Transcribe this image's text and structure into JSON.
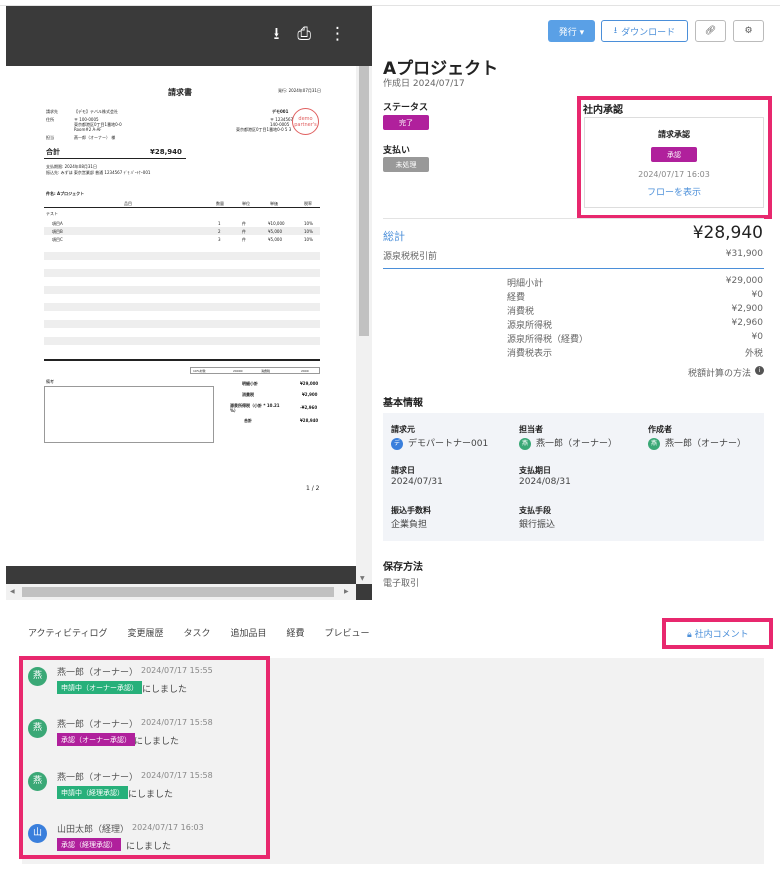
{
  "viewer": {
    "download_icon": "download-icon",
    "print_icon": "print-icon",
    "more_icon": "more-vert-icon",
    "page_indicator": "1 / 2",
    "invoice": {
      "title": "請求書",
      "issue_date": "発行: 2024年07月31日",
      "to_label": "請求先",
      "to_name": "【デモ】テバル株式会社",
      "address_label": "住所",
      "address_lines": [
        "〒 100-0005",
        "東京都港区0丁目1番地0-0",
        "Room#2 A-AF"
      ],
      "person_label": "担当",
      "person_name": "燕一郎（オーナー） 様",
      "from_company": "デモ001",
      "from_lines": [
        "〒 1234567",
        "140-0005",
        "東京都港区0丁目1番地0-0 5 3"
      ],
      "stamp_text": "demo partner's",
      "total_label": "合計",
      "total_value": "¥28,940",
      "due_line": "支払期限: 2024年08月31日",
      "bank_line": "振込先: みずほ 東京営業部 普通 1234567 ﾃﾞﾓ ﾊﾟｰﾄﾅｰ001",
      "subject": "件名: Aプロジェクト",
      "col_headers": [
        "品目",
        "数量",
        "単位",
        "単価",
        "税率"
      ],
      "group_label": "テスト",
      "rows": [
        [
          "項目A",
          "1",
          "件",
          "¥10,000",
          "10%"
        ],
        [
          "項目B",
          "2",
          "件",
          "¥5,000",
          "10%"
        ],
        [
          "項目C",
          "3",
          "件",
          "¥5,000",
          "10%"
        ]
      ],
      "tax_summary": [
        "10%対象",
        "29000",
        "消費税",
        "2900"
      ],
      "memo_label": "備考",
      "summary_labels": [
        "明細小計",
        "消費税",
        "源泉所得税（小計 * 10.21 %）",
        "合計"
      ],
      "summary_values": [
        "¥29,000",
        "¥2,900",
        "-¥2,960",
        "¥28,940"
      ]
    }
  },
  "toolbar": {
    "issue_label": "発行 ▾",
    "download_label": "ダウンロード",
    "link_icon": "link-icon",
    "gear_icon": "gear-icon"
  },
  "project": {
    "title": "Aプロジェクト",
    "created": "作成日 2024/07/17",
    "status_label": "ステータス",
    "status_badge": "完了",
    "payment_label": "支払い",
    "payment_badge": "未処理"
  },
  "approval": {
    "heading": "社内承認",
    "card_title": "請求承認",
    "badge": "承認",
    "timestamp": "2024/07/17 16:03",
    "flow_link": "フローを表示"
  },
  "totals": {
    "label": "総計",
    "value": "¥28,940",
    "pre_withholding_label": "源泉税税引前",
    "pre_withholding_value": "¥31,900",
    "breakdown": [
      {
        "label": "明細小計",
        "value": "¥29,000"
      },
      {
        "label": "経費",
        "value": "¥0"
      },
      {
        "label": "消費税",
        "value": "¥2,900"
      },
      {
        "label": "源泉所得税",
        "value": "¥2,960"
      },
      {
        "label": "源泉所得税（経費）",
        "value": "¥0"
      },
      {
        "label": "消費税表示",
        "value": "外税"
      }
    ],
    "tax_method_link": "税額計算の方法"
  },
  "basic": {
    "heading": "基本情報",
    "billing_to_label": "請求元",
    "billing_to_avatar": "デ",
    "billing_to_value": "デモパートナー001",
    "assignee_label": "担当者",
    "assignee_avatar": "燕",
    "assignee_value": "燕一郎（オーナー）",
    "creator_label": "作成者",
    "creator_avatar": "燕",
    "creator_value": "燕一郎（オーナー）",
    "invoice_date_label": "請求日",
    "invoice_date_value": "2024/07/31",
    "due_date_label": "支払期日",
    "due_date_value": "2024/08/31",
    "fee_label": "振込手数料",
    "fee_value": "企業負担",
    "method_label": "支払手段",
    "method_value": "銀行振込"
  },
  "storage": {
    "heading": "保存方法",
    "value": "電子取引"
  },
  "tabs": [
    "アクティビティログ",
    "変更履歴",
    "タスク",
    "追加品目",
    "経費",
    "プレビュー"
  ],
  "comment_tab": "社内コメント",
  "activity": [
    {
      "avatar": "燕",
      "name": "燕一郎（オーナー）",
      "time": "2024/07/17 15:55",
      "tag": "申請中（オーナー承認）",
      "tag_color": "#27b07a",
      "text": "にしました"
    },
    {
      "avatar": "燕",
      "name": "燕一郎（オーナー）",
      "time": "2024/07/17 15:58",
      "tag": "承認（オーナー承認）",
      "tag_color": "#b0209c",
      "text": "にしました"
    },
    {
      "avatar": "燕",
      "name": "燕一郎（オーナー）",
      "time": "2024/07/17 15:58",
      "tag": "申請中（経理承認）",
      "tag_color": "#27b07a",
      "text": "にしました"
    },
    {
      "avatar": "山",
      "name": "山田太郎（経理）",
      "time": "2024/07/17 16:03",
      "tag": "承認（経理承認）",
      "tag_color": "#b0209c",
      "text": "にしました"
    }
  ],
  "colors": {
    "accent": "#4b8fd9",
    "highlight": "#e8286e",
    "complete": "#b0209c",
    "pending": "#27b07a",
    "avatar_green": "#3aa876",
    "avatar_blue": "#3a7fdc"
  }
}
